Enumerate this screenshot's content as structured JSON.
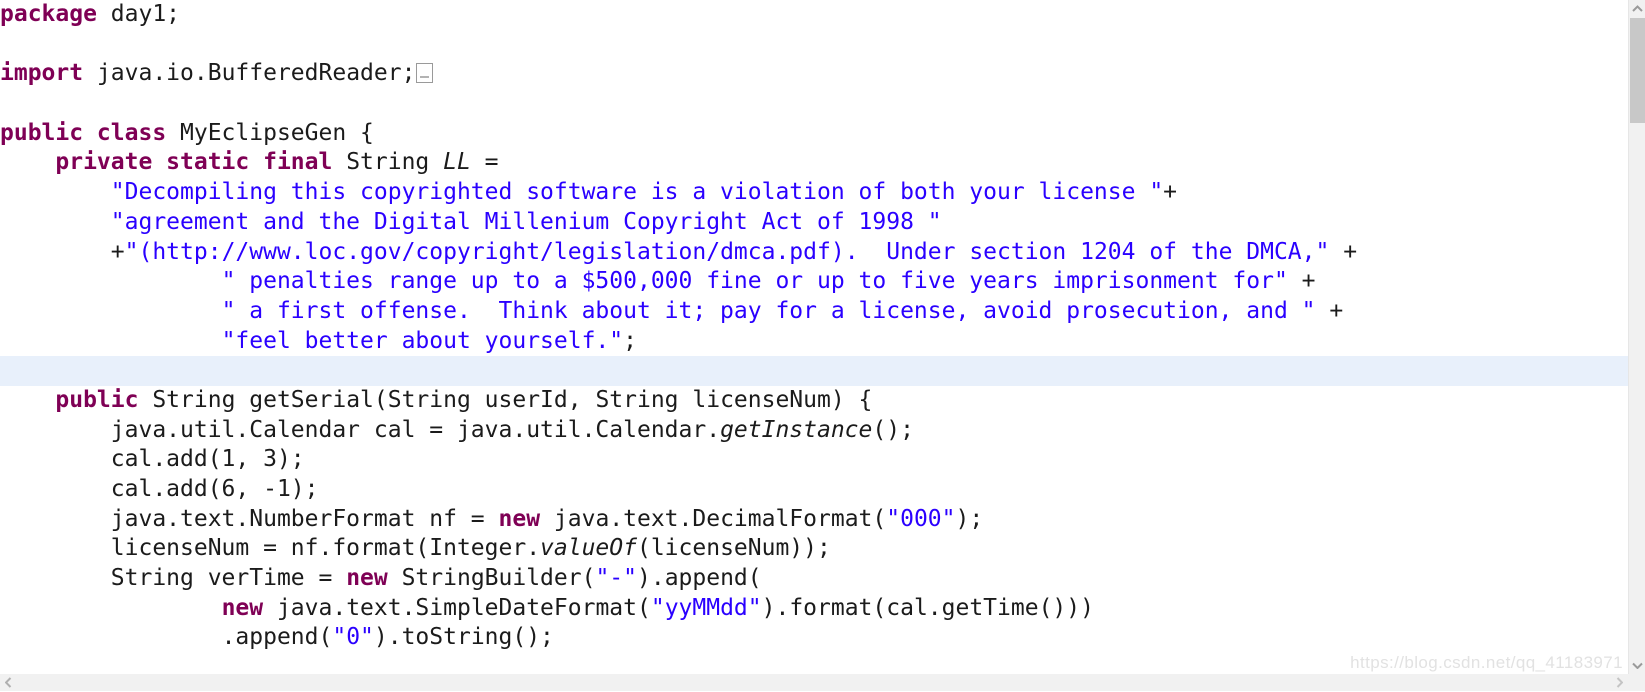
{
  "editor": {
    "language": "java",
    "background_color": "#ffffff",
    "highlight_color": "#e8f0fb",
    "keyword_color": "#7f0055",
    "string_color": "#2a00ff",
    "plain_color": "#1b1b1b"
  },
  "code": {
    "lines": [
      {
        "id": "line-package",
        "indent": 0,
        "highlighted": false,
        "tokens": [
          {
            "kind": "kw",
            "text": "package"
          },
          {
            "kind": "plain",
            "text": " day1;"
          }
        ]
      },
      {
        "id": "line-blank-1",
        "indent": 0,
        "highlighted": false,
        "tokens": []
      },
      {
        "id": "line-import",
        "indent": 0,
        "highlighted": false,
        "fold_marker": true,
        "tokens": [
          {
            "kind": "kw",
            "text": "import"
          },
          {
            "kind": "plain",
            "text": " java.io.BufferedReader;"
          }
        ]
      },
      {
        "id": "line-blank-2",
        "indent": 0,
        "highlighted": false,
        "tokens": []
      },
      {
        "id": "line-class-decl",
        "indent": 0,
        "highlighted": false,
        "tokens": [
          {
            "kind": "kw",
            "text": "public class"
          },
          {
            "kind": "plain",
            "text": " MyEclipseGen {"
          }
        ]
      },
      {
        "id": "line-field-ll",
        "indent": 1,
        "highlighted": false,
        "tokens": [
          {
            "kind": "kw",
            "text": "private static final"
          },
          {
            "kind": "plain",
            "text": " String "
          },
          {
            "kind": "field",
            "text": "LL"
          },
          {
            "kind": "plain",
            "text": " ="
          }
        ]
      },
      {
        "id": "line-ll-part-1",
        "indent": 2,
        "highlighted": false,
        "tokens": [
          {
            "kind": "str",
            "text": "\"Decompiling this copyrighted software is a violation of both your license \""
          },
          {
            "kind": "plain",
            "text": "+"
          }
        ]
      },
      {
        "id": "line-ll-part-2",
        "indent": 2,
        "highlighted": false,
        "tokens": [
          {
            "kind": "str",
            "text": "\"agreement and the Digital Millenium Copyright Act of 1998 \""
          }
        ]
      },
      {
        "id": "line-ll-part-3",
        "indent": 2,
        "highlighted": false,
        "tokens": [
          {
            "kind": "plain",
            "text": "+"
          },
          {
            "kind": "str",
            "text": "\"(http://www.loc.gov/copyright/legislation/dmca.pdf).  Under section 1204 of the DMCA,\""
          },
          {
            "kind": "plain",
            "text": " +"
          }
        ]
      },
      {
        "id": "line-ll-part-4",
        "indent": 4,
        "highlighted": false,
        "tokens": [
          {
            "kind": "str",
            "text": "\" penalties range up to a $500,000 fine or up to five years imprisonment for\""
          },
          {
            "kind": "plain",
            "text": " +"
          }
        ]
      },
      {
        "id": "line-ll-part-5",
        "indent": 4,
        "highlighted": false,
        "tokens": [
          {
            "kind": "str",
            "text": "\" a first offense.  Think about it; pay for a license, avoid prosecution, and \""
          },
          {
            "kind": "plain",
            "text": " +"
          }
        ]
      },
      {
        "id": "line-ll-part-6",
        "indent": 4,
        "highlighted": false,
        "tokens": [
          {
            "kind": "str",
            "text": "\"feel better about yourself.\""
          },
          {
            "kind": "plain",
            "text": ";"
          }
        ]
      },
      {
        "id": "line-blank-3-selected",
        "indent": 0,
        "highlighted": true,
        "tokens": []
      },
      {
        "id": "line-getserial-decl",
        "indent": 1,
        "highlighted": false,
        "tokens": [
          {
            "kind": "kw",
            "text": "public"
          },
          {
            "kind": "plain",
            "text": " String getSerial(String userId, String licenseNum) {"
          }
        ]
      },
      {
        "id": "line-calendar",
        "indent": 2,
        "highlighted": false,
        "tokens": [
          {
            "kind": "plain",
            "text": "java.util.Calendar cal = java.util.Calendar."
          },
          {
            "kind": "method",
            "text": "getInstance"
          },
          {
            "kind": "plain",
            "text": "();"
          }
        ]
      },
      {
        "id": "line-cal-add-1",
        "indent": 2,
        "highlighted": false,
        "tokens": [
          {
            "kind": "plain",
            "text": "cal.add(1, 3);"
          }
        ]
      },
      {
        "id": "line-cal-add-2",
        "indent": 2,
        "highlighted": false,
        "tokens": [
          {
            "kind": "plain",
            "text": "cal.add(6, -1);"
          }
        ]
      },
      {
        "id": "line-numberformat",
        "indent": 2,
        "highlighted": false,
        "tokens": [
          {
            "kind": "plain",
            "text": "java.text.NumberFormat nf = "
          },
          {
            "kind": "kw",
            "text": "new"
          },
          {
            "kind": "plain",
            "text": " java.text.DecimalFormat("
          },
          {
            "kind": "str",
            "text": "\"000\""
          },
          {
            "kind": "plain",
            "text": ");"
          }
        ]
      },
      {
        "id": "line-licensenum",
        "indent": 2,
        "highlighted": false,
        "tokens": [
          {
            "kind": "plain",
            "text": "licenseNum = nf.format(Integer."
          },
          {
            "kind": "method",
            "text": "valueOf"
          },
          {
            "kind": "plain",
            "text": "(licenseNum));"
          }
        ]
      },
      {
        "id": "line-vertime",
        "indent": 2,
        "highlighted": false,
        "tokens": [
          {
            "kind": "plain",
            "text": "String verTime = "
          },
          {
            "kind": "kw",
            "text": "new"
          },
          {
            "kind": "plain",
            "text": " StringBuilder("
          },
          {
            "kind": "str",
            "text": "\"-\""
          },
          {
            "kind": "plain",
            "text": ").append("
          }
        ]
      },
      {
        "id": "line-simpledateformat",
        "indent": 4,
        "highlighted": false,
        "tokens": [
          {
            "kind": "kw",
            "text": "new"
          },
          {
            "kind": "plain",
            "text": " java.text.SimpleDateFormat("
          },
          {
            "kind": "str",
            "text": "\"yyMMdd\""
          },
          {
            "kind": "plain",
            "text": ").format(cal.getTime()))"
          }
        ]
      },
      {
        "id": "line-append-zero",
        "indent": 4,
        "highlighted": false,
        "tokens": [
          {
            "kind": "plain",
            "text": ".append("
          },
          {
            "kind": "str",
            "text": "\"0\""
          },
          {
            "kind": "plain",
            "text": ").toString();"
          }
        ]
      }
    ]
  },
  "scrollbars": {
    "vertical": {
      "up_arrow_icon": "chevron-up-icon",
      "down_arrow_icon": "chevron-down-icon",
      "thumb_color": "#c8c8c8",
      "track_color": "#f1f1f1"
    },
    "horizontal": {
      "left_arrow_icon": "chevron-left-icon",
      "right_arrow_icon": "chevron-right-icon",
      "track_color": "#f1f1f1"
    }
  },
  "watermark": {
    "text": "https://blog.csdn.net/qq_41183971"
  }
}
